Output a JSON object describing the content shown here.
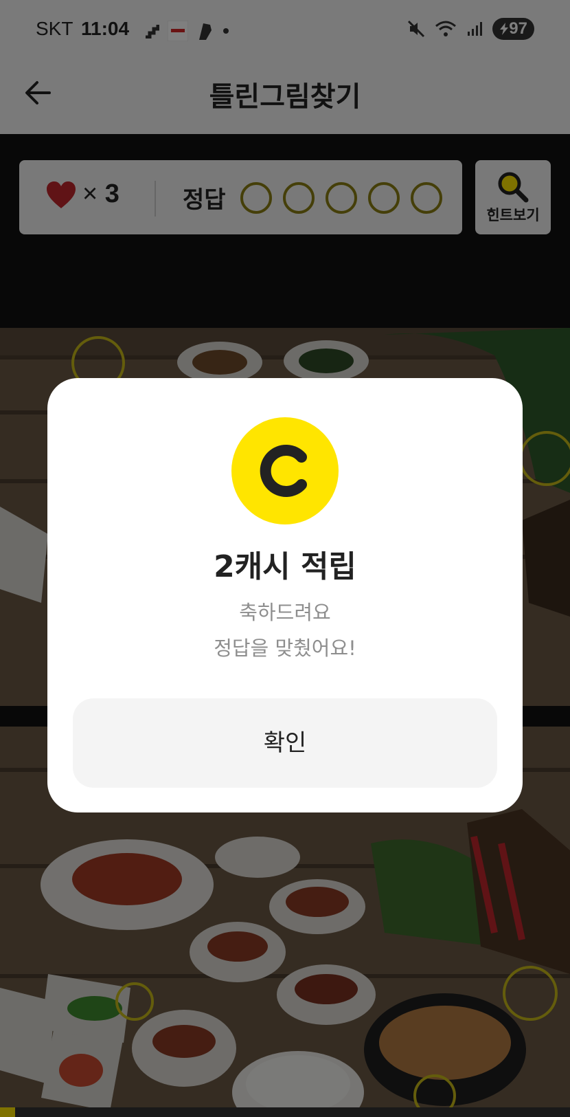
{
  "status_bar": {
    "carrier": "SKT",
    "time": "11:04",
    "battery": "97",
    "icons": [
      "stairs-icon",
      "news-app-icon",
      "shoe-icon",
      "dot-icon",
      "mute-icon",
      "wifi-icon",
      "signal-icon",
      "charging-icon"
    ]
  },
  "header": {
    "title": "틀린그림찾기",
    "back_icon": "back-arrow-icon"
  },
  "score": {
    "lives_symbol": "×",
    "lives_count": "3",
    "answer_label": "정답",
    "answers_found": 0,
    "answers_total": 5
  },
  "hint": {
    "label": "힌트보기",
    "icon": "magnifier-icon"
  },
  "modal": {
    "coin_letter": "C",
    "title": "2캐시 적립",
    "message_line1": "축하드려요",
    "message_line2": "정답을 맞췄어요!",
    "confirm_label": "확인"
  },
  "colors": {
    "accent_yellow": "#ffe500",
    "ring_olive": "#8a7f12",
    "heart_red": "#c0262d",
    "modal_bg": "#ffffff",
    "button_bg": "#f4f4f4"
  }
}
